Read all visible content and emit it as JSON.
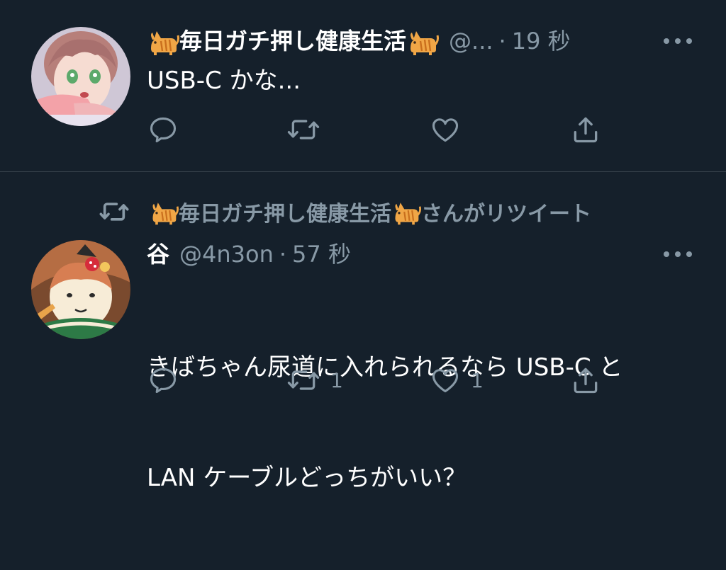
{
  "colors": {
    "background": "#15202b",
    "divider": "#38444d",
    "secondary_text": "#8899a6",
    "primary_text": "#ffffff"
  },
  "tweets": [
    {
      "author_name": "毎日ガチ押し健康生活",
      "author_handle": "@...",
      "separator": "·",
      "time": "19 秒",
      "text": "USB-C かな...",
      "emoji": "cat-emoji",
      "actions": {
        "reply": {
          "icon": "reply-icon",
          "count": ""
        },
        "retweet": {
          "icon": "retweet-icon",
          "count": ""
        },
        "like": {
          "icon": "heart-icon",
          "count": ""
        },
        "share": {
          "icon": "share-icon",
          "count": ""
        }
      }
    },
    {
      "retweet_context": {
        "retweeter_name": "毎日ガチ押し健康生活",
        "suffix": "さんがリツイート"
      },
      "author_name": "谷",
      "author_handle": "@4n3on",
      "separator": "·",
      "time": "57 秒",
      "text_line1": "きばちゃん尿道に入れられるなら USB-C と",
      "text_line2": "LAN ケーブルどっちがいい？",
      "actions": {
        "reply": {
          "icon": "reply-icon",
          "count": ""
        },
        "retweet": {
          "icon": "retweet-icon",
          "count": "1"
        },
        "like": {
          "icon": "heart-icon",
          "count": "1"
        },
        "share": {
          "icon": "share-icon",
          "count": ""
        }
      }
    }
  ]
}
